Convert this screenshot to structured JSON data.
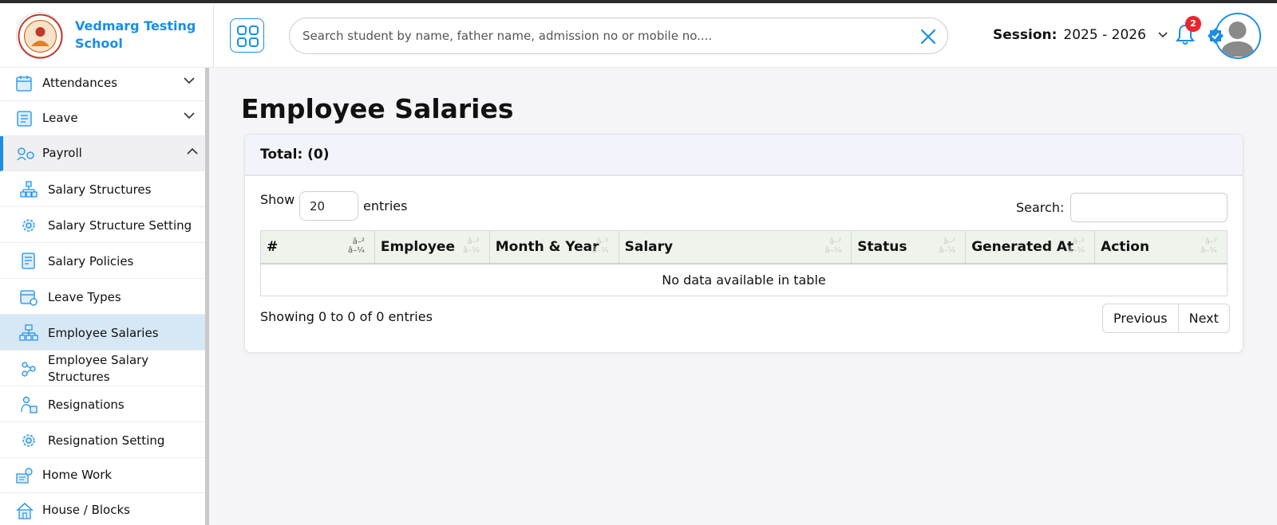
{
  "brand": {
    "name": "Vedmarg Testing School"
  },
  "search": {
    "placeholder": "Search student by name, father name, admission no or mobile no...."
  },
  "session": {
    "label": "Session:",
    "value": "2025 - 2026"
  },
  "notifications": {
    "count": "2"
  },
  "sidebar": {
    "items": [
      {
        "label": "Attendances",
        "icon": "calendar-icon",
        "chevron": "down"
      },
      {
        "label": "Leave",
        "icon": "document-icon",
        "chevron": "down"
      },
      {
        "label": "Payroll",
        "icon": "payroll-icon",
        "chevron": "up"
      }
    ],
    "payroll_sub": [
      {
        "label": "Salary Structures",
        "icon": "hierarchy-icon"
      },
      {
        "label": "Salary Structure Setting",
        "icon": "gear-icon"
      },
      {
        "label": "Salary Policies",
        "icon": "policy-icon"
      },
      {
        "label": "Leave Types",
        "icon": "calendar-gear-icon"
      },
      {
        "label": "Employee Salaries",
        "icon": "org-chart-icon"
      },
      {
        "label": "Employee Salary Structures",
        "icon": "structure-icon"
      },
      {
        "label": "Resignations",
        "icon": "resignation-icon"
      },
      {
        "label": "Resignation Setting",
        "icon": "gear-icon"
      }
    ],
    "bottom": [
      {
        "label": "Home Work",
        "icon": "homework-icon"
      },
      {
        "label": "House / Blocks",
        "icon": "house-icon"
      }
    ]
  },
  "page": {
    "title": "Employee Salaries"
  },
  "card": {
    "total": "Total: (0)",
    "show_label": "Show",
    "page_size": "20",
    "entries_label": "entries",
    "search_label": "Search:",
    "columns": [
      "#",
      "Employee",
      "Month & Year",
      "Salary",
      "Status",
      "Generated At",
      "Action"
    ],
    "sort_glyph_top": "â–²",
    "sort_glyph_bottom": "â–¼",
    "empty_message": "No data available in table",
    "info": "Showing 0 to 0 of 0 entries",
    "prev": "Previous",
    "next": "Next"
  }
}
